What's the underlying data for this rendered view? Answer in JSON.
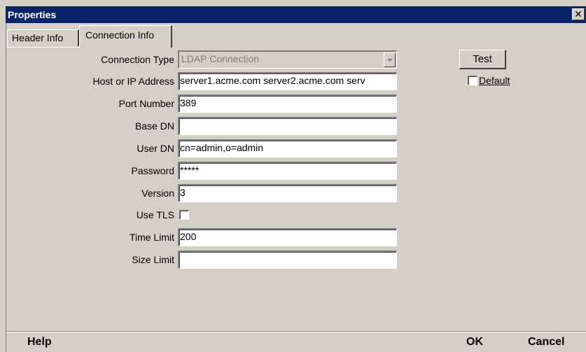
{
  "window": {
    "title": "Properties",
    "close_glyph": "✕",
    "close_icon": "close-icon"
  },
  "tabs": [
    {
      "label": "Header Info",
      "active": false
    },
    {
      "label": "Connection Info",
      "active": true
    }
  ],
  "form": {
    "connection_type": {
      "label": "Connection Type",
      "value": "LDAP Connection",
      "disabled": true
    },
    "host": {
      "label": "Host or IP Address",
      "value": "server1.acme.com server2.acme.com serv"
    },
    "port": {
      "label": "Port Number",
      "value": "389"
    },
    "base_dn": {
      "label": "Base DN",
      "value": ""
    },
    "user_dn": {
      "label": "User DN",
      "value": "cn=admin,o=admin"
    },
    "password": {
      "label": "Password",
      "value": "*****"
    },
    "version": {
      "label": "Version",
      "value": "3"
    },
    "use_tls": {
      "label": "Use TLS",
      "checked": false
    },
    "time_limit": {
      "label": "Time Limit",
      "value": "200"
    },
    "size_limit": {
      "label": "Size Limit",
      "value": ""
    }
  },
  "side": {
    "test_label": "Test",
    "default_label": "Default",
    "default_checked": false
  },
  "footer": {
    "help_label": "Help",
    "ok_label": "OK",
    "cancel_label": "Cancel"
  }
}
